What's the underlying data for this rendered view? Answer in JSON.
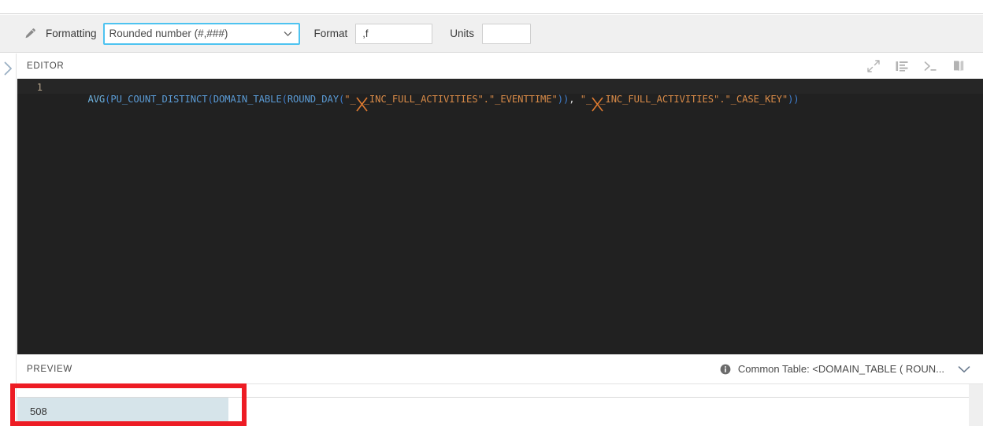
{
  "toolbar": {
    "edit_icon": "pencil-icon",
    "formatting_label": "Formatting",
    "formatting_value": "Rounded number (#,###)",
    "formatting_options": [
      "Rounded number (#,###)"
    ],
    "format_label": "Format",
    "format_value": ",f",
    "units_label": "Units",
    "units_value": "",
    "focus_border_color": "#4ec3f0"
  },
  "rail": {
    "expand_icon": "chevron-right-icon"
  },
  "editor": {
    "title": "EDITOR",
    "line_number": "1",
    "tools": [
      {
        "icon": "expand-arrows-icon",
        "name": "expand-editor-button"
      },
      {
        "icon": "format-indent-icon",
        "name": "format-code-button"
      },
      {
        "icon": "terminal-prompt-icon",
        "name": "console-button"
      },
      {
        "icon": "book-icon",
        "name": "documentation-button"
      }
    ],
    "code_tokens": [
      {
        "t": "AVG",
        "c": "fn"
      },
      {
        "t": "(",
        "c": "paren"
      },
      {
        "t": "PU_COUNT_DISTINCT",
        "c": "fn2"
      },
      {
        "t": "(",
        "c": "paren"
      },
      {
        "t": "DOMAIN_TABLE",
        "c": "fn2"
      },
      {
        "t": "(",
        "c": "paren"
      },
      {
        "t": "ROUND_DAY",
        "c": "fn2"
      },
      {
        "t": "(",
        "c": "paren"
      },
      {
        "t": "\"_",
        "c": "str"
      },
      {
        "t": "MASK",
        "c": "mask"
      },
      {
        "t": "_INC_FULL_ACTIVITIES\".\"_EVENTTIME\"",
        "c": "str"
      },
      {
        "t": "))",
        "c": "paren"
      },
      {
        "t": ", ",
        "c": "comma"
      },
      {
        "t": "\"_",
        "c": "str"
      },
      {
        "t": "MASK",
        "c": "mask"
      },
      {
        "t": "_INC_FULL_ACTIVITIES\".\"_CASE_KEY\"",
        "c": "str"
      },
      {
        "t": "))",
        "c": "paren"
      }
    ],
    "code_plain": "AVG(PU_COUNT_DISTINCT(DOMAIN_TABLE(ROUND_DAY(\"_X_INC_FULL_ACTIVITIES\".\"_EVENTTIME\")), \"_X_INC_FULL_ACTIVITIES\".\"_CASE_KEY\"))",
    "background_color": "#262626"
  },
  "preview": {
    "title": "PREVIEW",
    "info_icon": "info-icon",
    "common_table_text": "Common Table: <DOMAIN_TABLE ( ROUN...",
    "collapse_icon": "chevron-down-icon",
    "table": {
      "headers": [
        ""
      ],
      "rows": [
        [
          "508"
        ]
      ]
    },
    "highlight_color": "#d6e4ea"
  },
  "annotation": {
    "highlight_box_color": "#ed1c24"
  }
}
